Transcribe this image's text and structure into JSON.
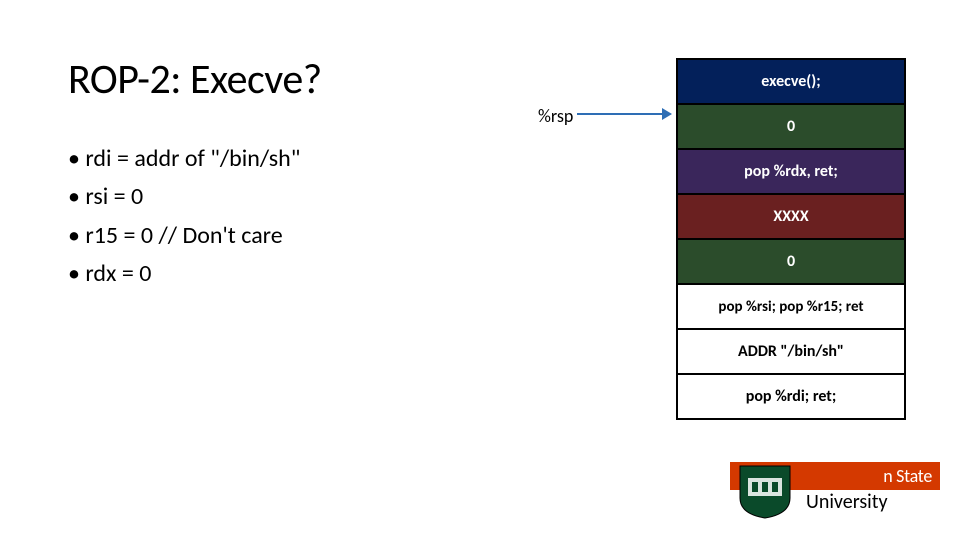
{
  "title": "ROP-2: Execve?",
  "bullets": [
    "rdi = addr of \"/bin/sh\"",
    "rsi = 0",
    "r15 = 0     // Don't care",
    "rdx = 0"
  ],
  "rsp_label": "%rsp",
  "stack": [
    {
      "text": "execve();",
      "cls": "c-blue"
    },
    {
      "text": "0",
      "cls": "c-green"
    },
    {
      "text": "pop %rdx, ret;",
      "cls": "c-purple"
    },
    {
      "text": "XXXX",
      "cls": "c-red"
    },
    {
      "text": "0",
      "cls": "c-green"
    },
    {
      "text": "pop %rsi; pop %r15; ret",
      "cls": "c-white narrow"
    },
    {
      "text": "ADDR \"/bin/sh\"",
      "cls": "c-grey"
    },
    {
      "text": "pop %rdi; ret;",
      "cls": "c-white"
    }
  ],
  "logo": {
    "top": "n State",
    "bottom": "University"
  }
}
